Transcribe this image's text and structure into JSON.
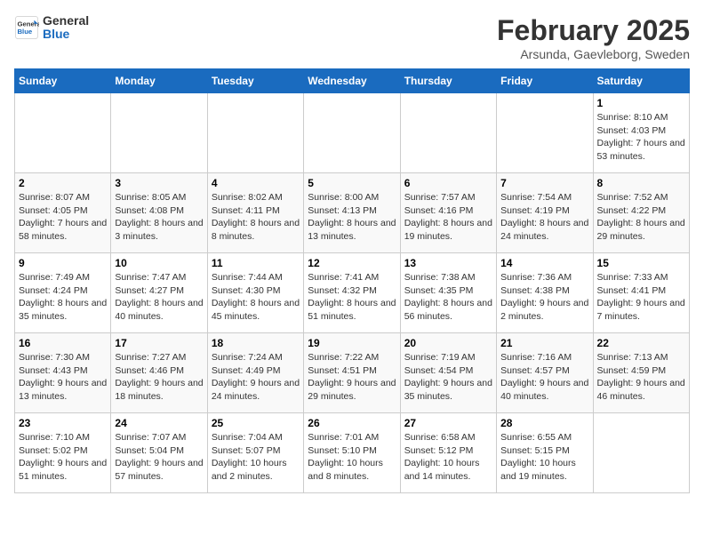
{
  "logo": {
    "line1": "General",
    "line2": "Blue"
  },
  "title": "February 2025",
  "subtitle": "Arsunda, Gaevleborg, Sweden",
  "weekdays": [
    "Sunday",
    "Monday",
    "Tuesday",
    "Wednesday",
    "Thursday",
    "Friday",
    "Saturday"
  ],
  "weeks": [
    [
      {
        "day": "",
        "info": ""
      },
      {
        "day": "",
        "info": ""
      },
      {
        "day": "",
        "info": ""
      },
      {
        "day": "",
        "info": ""
      },
      {
        "day": "",
        "info": ""
      },
      {
        "day": "",
        "info": ""
      },
      {
        "day": "1",
        "info": "Sunrise: 8:10 AM\nSunset: 4:03 PM\nDaylight: 7 hours and 53 minutes."
      }
    ],
    [
      {
        "day": "2",
        "info": "Sunrise: 8:07 AM\nSunset: 4:05 PM\nDaylight: 7 hours and 58 minutes."
      },
      {
        "day": "3",
        "info": "Sunrise: 8:05 AM\nSunset: 4:08 PM\nDaylight: 8 hours and 3 minutes."
      },
      {
        "day": "4",
        "info": "Sunrise: 8:02 AM\nSunset: 4:11 PM\nDaylight: 8 hours and 8 minutes."
      },
      {
        "day": "5",
        "info": "Sunrise: 8:00 AM\nSunset: 4:13 PM\nDaylight: 8 hours and 13 minutes."
      },
      {
        "day": "6",
        "info": "Sunrise: 7:57 AM\nSunset: 4:16 PM\nDaylight: 8 hours and 19 minutes."
      },
      {
        "day": "7",
        "info": "Sunrise: 7:54 AM\nSunset: 4:19 PM\nDaylight: 8 hours and 24 minutes."
      },
      {
        "day": "8",
        "info": "Sunrise: 7:52 AM\nSunset: 4:22 PM\nDaylight: 8 hours and 29 minutes."
      }
    ],
    [
      {
        "day": "9",
        "info": "Sunrise: 7:49 AM\nSunset: 4:24 PM\nDaylight: 8 hours and 35 minutes."
      },
      {
        "day": "10",
        "info": "Sunrise: 7:47 AM\nSunset: 4:27 PM\nDaylight: 8 hours and 40 minutes."
      },
      {
        "day": "11",
        "info": "Sunrise: 7:44 AM\nSunset: 4:30 PM\nDaylight: 8 hours and 45 minutes."
      },
      {
        "day": "12",
        "info": "Sunrise: 7:41 AM\nSunset: 4:32 PM\nDaylight: 8 hours and 51 minutes."
      },
      {
        "day": "13",
        "info": "Sunrise: 7:38 AM\nSunset: 4:35 PM\nDaylight: 8 hours and 56 minutes."
      },
      {
        "day": "14",
        "info": "Sunrise: 7:36 AM\nSunset: 4:38 PM\nDaylight: 9 hours and 2 minutes."
      },
      {
        "day": "15",
        "info": "Sunrise: 7:33 AM\nSunset: 4:41 PM\nDaylight: 9 hours and 7 minutes."
      }
    ],
    [
      {
        "day": "16",
        "info": "Sunrise: 7:30 AM\nSunset: 4:43 PM\nDaylight: 9 hours and 13 minutes."
      },
      {
        "day": "17",
        "info": "Sunrise: 7:27 AM\nSunset: 4:46 PM\nDaylight: 9 hours and 18 minutes."
      },
      {
        "day": "18",
        "info": "Sunrise: 7:24 AM\nSunset: 4:49 PM\nDaylight: 9 hours and 24 minutes."
      },
      {
        "day": "19",
        "info": "Sunrise: 7:22 AM\nSunset: 4:51 PM\nDaylight: 9 hours and 29 minutes."
      },
      {
        "day": "20",
        "info": "Sunrise: 7:19 AM\nSunset: 4:54 PM\nDaylight: 9 hours and 35 minutes."
      },
      {
        "day": "21",
        "info": "Sunrise: 7:16 AM\nSunset: 4:57 PM\nDaylight: 9 hours and 40 minutes."
      },
      {
        "day": "22",
        "info": "Sunrise: 7:13 AM\nSunset: 4:59 PM\nDaylight: 9 hours and 46 minutes."
      }
    ],
    [
      {
        "day": "23",
        "info": "Sunrise: 7:10 AM\nSunset: 5:02 PM\nDaylight: 9 hours and 51 minutes."
      },
      {
        "day": "24",
        "info": "Sunrise: 7:07 AM\nSunset: 5:04 PM\nDaylight: 9 hours and 57 minutes."
      },
      {
        "day": "25",
        "info": "Sunrise: 7:04 AM\nSunset: 5:07 PM\nDaylight: 10 hours and 2 minutes."
      },
      {
        "day": "26",
        "info": "Sunrise: 7:01 AM\nSunset: 5:10 PM\nDaylight: 10 hours and 8 minutes."
      },
      {
        "day": "27",
        "info": "Sunrise: 6:58 AM\nSunset: 5:12 PM\nDaylight: 10 hours and 14 minutes."
      },
      {
        "day": "28",
        "info": "Sunrise: 6:55 AM\nSunset: 5:15 PM\nDaylight: 10 hours and 19 minutes."
      },
      {
        "day": "",
        "info": ""
      }
    ]
  ]
}
